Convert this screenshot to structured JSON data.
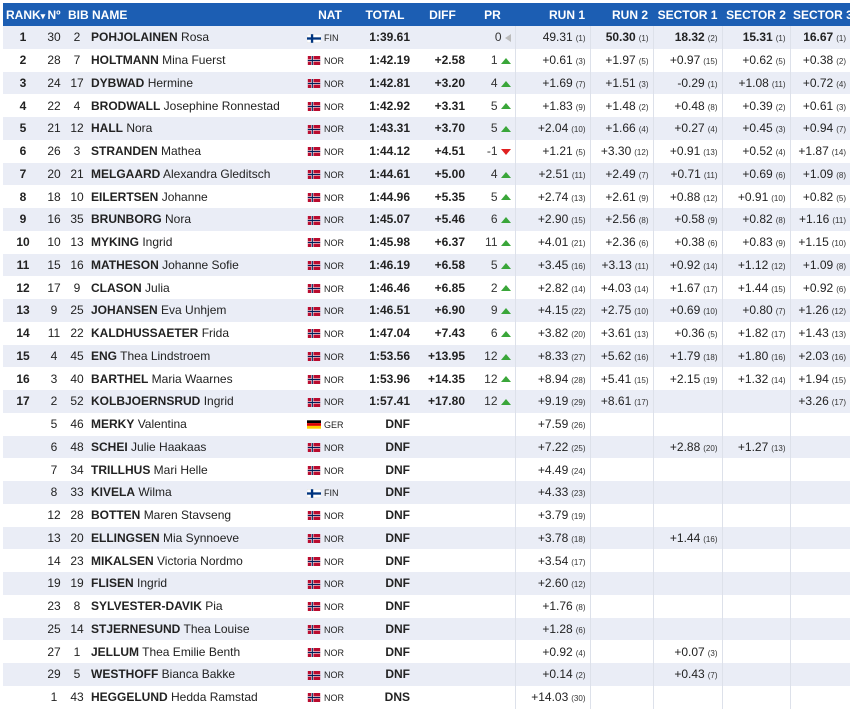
{
  "headers": [
    "RANK",
    "Nº",
    "BIB",
    "NAME",
    "NAT",
    "TOTAL",
    "DIFF",
    "PR",
    "RUN 1",
    "RUN 2",
    "SECTOR 1",
    "SECTOR 2",
    "SECTOR 3"
  ],
  "sort_indicator": "▾",
  "colors": {
    "header_bg": "#1c5eb3",
    "row_alt": "#eaedf6",
    "up": "#3aa63a",
    "down": "#e02020"
  },
  "rows": [
    {
      "rank": "1",
      "no": "30",
      "bib": "2",
      "surname": "POHJOLAINEN",
      "first": "Rosa",
      "nat": "FIN",
      "total": "1:39.61",
      "diff": "",
      "pr": "0",
      "pr_dir": "same",
      "run1": "49.31",
      "run1_rank": "(1)",
      "run2": "50.30",
      "run2_rank": "(1)",
      "s1": "18.32",
      "s1_rank": "(2)",
      "s2": "15.31",
      "s2_rank": "(1)",
      "s3": "16.67",
      "s3_rank": "(1)",
      "best": true
    },
    {
      "rank": "2",
      "no": "28",
      "bib": "7",
      "surname": "HOLTMANN",
      "first": "Mina Fuerst",
      "nat": "NOR",
      "total": "1:42.19",
      "diff": "+2.58",
      "pr": "1",
      "pr_dir": "up",
      "run1": "+0.61",
      "run1_rank": "(3)",
      "run2": "+1.97",
      "run2_rank": "(5)",
      "s1": "+0.97",
      "s1_rank": "(15)",
      "s2": "+0.62",
      "s2_rank": "(5)",
      "s3": "+0.38",
      "s3_rank": "(2)"
    },
    {
      "rank": "3",
      "no": "24",
      "bib": "17",
      "surname": "DYBWAD",
      "first": "Hermine",
      "nat": "NOR",
      "total": "1:42.81",
      "diff": "+3.20",
      "pr": "4",
      "pr_dir": "up",
      "run1": "+1.69",
      "run1_rank": "(7)",
      "run2": "+1.51",
      "run2_rank": "(3)",
      "s1": "-0.29",
      "s1_rank": "(1)",
      "s2": "+1.08",
      "s2_rank": "(11)",
      "s3": "+0.72",
      "s3_rank": "(4)"
    },
    {
      "rank": "4",
      "no": "22",
      "bib": "4",
      "surname": "BRODWALL",
      "first": "Josephine Ronnestad",
      "nat": "NOR",
      "total": "1:42.92",
      "diff": "+3.31",
      "pr": "5",
      "pr_dir": "up",
      "run1": "+1.83",
      "run1_rank": "(9)",
      "run2": "+1.48",
      "run2_rank": "(2)",
      "s1": "+0.48",
      "s1_rank": "(8)",
      "s2": "+0.39",
      "s2_rank": "(2)",
      "s3": "+0.61",
      "s3_rank": "(3)"
    },
    {
      "rank": "5",
      "no": "21",
      "bib": "12",
      "surname": "HALL",
      "first": "Nora",
      "nat": "NOR",
      "total": "1:43.31",
      "diff": "+3.70",
      "pr": "5",
      "pr_dir": "up",
      "run1": "+2.04",
      "run1_rank": "(10)",
      "run2": "+1.66",
      "run2_rank": "(4)",
      "s1": "+0.27",
      "s1_rank": "(4)",
      "s2": "+0.45",
      "s2_rank": "(3)",
      "s3": "+0.94",
      "s3_rank": "(7)"
    },
    {
      "rank": "6",
      "no": "26",
      "bib": "3",
      "surname": "STRANDEN",
      "first": "Mathea",
      "nat": "NOR",
      "total": "1:44.12",
      "diff": "+4.51",
      "pr": "-1",
      "pr_dir": "down",
      "run1": "+1.21",
      "run1_rank": "(5)",
      "run2": "+3.30",
      "run2_rank": "(12)",
      "s1": "+0.91",
      "s1_rank": "(13)",
      "s2": "+0.52",
      "s2_rank": "(4)",
      "s3": "+1.87",
      "s3_rank": "(14)"
    },
    {
      "rank": "7",
      "no": "20",
      "bib": "21",
      "surname": "MELGAARD",
      "first": "Alexandra Gleditsch",
      "nat": "NOR",
      "total": "1:44.61",
      "diff": "+5.00",
      "pr": "4",
      "pr_dir": "up",
      "run1": "+2.51",
      "run1_rank": "(11)",
      "run2": "+2.49",
      "run2_rank": "(7)",
      "s1": "+0.71",
      "s1_rank": "(11)",
      "s2": "+0.69",
      "s2_rank": "(6)",
      "s3": "+1.09",
      "s3_rank": "(8)"
    },
    {
      "rank": "8",
      "no": "18",
      "bib": "10",
      "surname": "EILERTSEN",
      "first": "Johanne",
      "nat": "NOR",
      "total": "1:44.96",
      "diff": "+5.35",
      "pr": "5",
      "pr_dir": "up",
      "run1": "+2.74",
      "run1_rank": "(13)",
      "run2": "+2.61",
      "run2_rank": "(9)",
      "s1": "+0.88",
      "s1_rank": "(12)",
      "s2": "+0.91",
      "s2_rank": "(10)",
      "s3": "+0.82",
      "s3_rank": "(5)"
    },
    {
      "rank": "9",
      "no": "16",
      "bib": "35",
      "surname": "BRUNBORG",
      "first": "Nora",
      "nat": "NOR",
      "total": "1:45.07",
      "diff": "+5.46",
      "pr": "6",
      "pr_dir": "up",
      "run1": "+2.90",
      "run1_rank": "(15)",
      "run2": "+2.56",
      "run2_rank": "(8)",
      "s1": "+0.58",
      "s1_rank": "(9)",
      "s2": "+0.82",
      "s2_rank": "(8)",
      "s3": "+1.16",
      "s3_rank": "(11)"
    },
    {
      "rank": "10",
      "no": "10",
      "bib": "13",
      "surname": "MYKING",
      "first": "Ingrid",
      "nat": "NOR",
      "total": "1:45.98",
      "diff": "+6.37",
      "pr": "11",
      "pr_dir": "up",
      "run1": "+4.01",
      "run1_rank": "(21)",
      "run2": "+2.36",
      "run2_rank": "(6)",
      "s1": "+0.38",
      "s1_rank": "(6)",
      "s2": "+0.83",
      "s2_rank": "(9)",
      "s3": "+1.15",
      "s3_rank": "(10)"
    },
    {
      "rank": "11",
      "no": "15",
      "bib": "16",
      "surname": "MATHESON",
      "first": "Johanne Sofie",
      "nat": "NOR",
      "total": "1:46.19",
      "diff": "+6.58",
      "pr": "5",
      "pr_dir": "up",
      "run1": "+3.45",
      "run1_rank": "(16)",
      "run2": "+3.13",
      "run2_rank": "(11)",
      "s1": "+0.92",
      "s1_rank": "(14)",
      "s2": "+1.12",
      "s2_rank": "(12)",
      "s3": "+1.09",
      "s3_rank": "(8)"
    },
    {
      "rank": "12",
      "no": "17",
      "bib": "9",
      "surname": "CLASON",
      "first": "Julia",
      "nat": "NOR",
      "total": "1:46.46",
      "diff": "+6.85",
      "pr": "2",
      "pr_dir": "up",
      "run1": "+2.82",
      "run1_rank": "(14)",
      "run2": "+4.03",
      "run2_rank": "(14)",
      "s1": "+1.67",
      "s1_rank": "(17)",
      "s2": "+1.44",
      "s2_rank": "(15)",
      "s3": "+0.92",
      "s3_rank": "(6)"
    },
    {
      "rank": "13",
      "no": "9",
      "bib": "25",
      "surname": "JOHANSEN",
      "first": "Eva Unhjem",
      "nat": "NOR",
      "total": "1:46.51",
      "diff": "+6.90",
      "pr": "9",
      "pr_dir": "up",
      "run1": "+4.15",
      "run1_rank": "(22)",
      "run2": "+2.75",
      "run2_rank": "(10)",
      "s1": "+0.69",
      "s1_rank": "(10)",
      "s2": "+0.80",
      "s2_rank": "(7)",
      "s3": "+1.26",
      "s3_rank": "(12)"
    },
    {
      "rank": "14",
      "no": "11",
      "bib": "22",
      "surname": "KALDHUSSAETER",
      "first": "Frida",
      "nat": "NOR",
      "total": "1:47.04",
      "diff": "+7.43",
      "pr": "6",
      "pr_dir": "up",
      "run1": "+3.82",
      "run1_rank": "(20)",
      "run2": "+3.61",
      "run2_rank": "(13)",
      "s1": "+0.36",
      "s1_rank": "(5)",
      "s2": "+1.82",
      "s2_rank": "(17)",
      "s3": "+1.43",
      "s3_rank": "(13)"
    },
    {
      "rank": "15",
      "no": "4",
      "bib": "45",
      "surname": "ENG",
      "first": "Thea Lindstroem",
      "nat": "NOR",
      "total": "1:53.56",
      "diff": "+13.95",
      "pr": "12",
      "pr_dir": "up",
      "run1": "+8.33",
      "run1_rank": "(27)",
      "run2": "+5.62",
      "run2_rank": "(16)",
      "s1": "+1.79",
      "s1_rank": "(18)",
      "s2": "+1.80",
      "s2_rank": "(16)",
      "s3": "+2.03",
      "s3_rank": "(16)"
    },
    {
      "rank": "16",
      "no": "3",
      "bib": "40",
      "surname": "BARTHEL",
      "first": "Maria Waarnes",
      "nat": "NOR",
      "total": "1:53.96",
      "diff": "+14.35",
      "pr": "12",
      "pr_dir": "up",
      "run1": "+8.94",
      "run1_rank": "(28)",
      "run2": "+5.41",
      "run2_rank": "(15)",
      "s1": "+2.15",
      "s1_rank": "(19)",
      "s2": "+1.32",
      "s2_rank": "(14)",
      "s3": "+1.94",
      "s3_rank": "(15)"
    },
    {
      "rank": "17",
      "no": "2",
      "bib": "52",
      "surname": "KOLBJOERNSRUD",
      "first": "Ingrid",
      "nat": "NOR",
      "total": "1:57.41",
      "diff": "+17.80",
      "pr": "12",
      "pr_dir": "up",
      "run1": "+9.19",
      "run1_rank": "(29)",
      "run2": "+8.61",
      "run2_rank": "(17)",
      "s1": "",
      "s1_rank": "",
      "s2": "",
      "s2_rank": "",
      "s3": "+3.26",
      "s3_rank": "(17)"
    },
    {
      "rank": "",
      "no": "5",
      "bib": "46",
      "surname": "MERKY",
      "first": "Valentina",
      "nat": "GER",
      "total": "DNF",
      "diff": "",
      "pr": "",
      "pr_dir": "",
      "run1": "+7.59",
      "run1_rank": "(26)",
      "run2": "",
      "run2_rank": "",
      "s1": "",
      "s1_rank": "",
      "s2": "",
      "s2_rank": "",
      "s3": "",
      "s3_rank": ""
    },
    {
      "rank": "",
      "no": "6",
      "bib": "48",
      "surname": "SCHEI",
      "first": "Julie Haakaas",
      "nat": "NOR",
      "total": "DNF",
      "diff": "",
      "pr": "",
      "pr_dir": "",
      "run1": "+7.22",
      "run1_rank": "(25)",
      "run2": "",
      "run2_rank": "",
      "s1": "+2.88",
      "s1_rank": "(20)",
      "s2": "+1.27",
      "s2_rank": "(13)",
      "s3": "",
      "s3_rank": ""
    },
    {
      "rank": "",
      "no": "7",
      "bib": "34",
      "surname": "TRILLHUS",
      "first": "Mari Helle",
      "nat": "NOR",
      "total": "DNF",
      "diff": "",
      "pr": "",
      "pr_dir": "",
      "run1": "+4.49",
      "run1_rank": "(24)",
      "run2": "",
      "run2_rank": "",
      "s1": "",
      "s1_rank": "",
      "s2": "",
      "s2_rank": "",
      "s3": "",
      "s3_rank": ""
    },
    {
      "rank": "",
      "no": "8",
      "bib": "33",
      "surname": "KIVELA",
      "first": "Wilma",
      "nat": "FIN",
      "total": "DNF",
      "diff": "",
      "pr": "",
      "pr_dir": "",
      "run1": "+4.33",
      "run1_rank": "(23)",
      "run2": "",
      "run2_rank": "",
      "s1": "",
      "s1_rank": "",
      "s2": "",
      "s2_rank": "",
      "s3": "",
      "s3_rank": ""
    },
    {
      "rank": "",
      "no": "12",
      "bib": "28",
      "surname": "BOTTEN",
      "first": "Maren Stavseng",
      "nat": "NOR",
      "total": "DNF",
      "diff": "",
      "pr": "",
      "pr_dir": "",
      "run1": "+3.79",
      "run1_rank": "(19)",
      "run2": "",
      "run2_rank": "",
      "s1": "",
      "s1_rank": "",
      "s2": "",
      "s2_rank": "",
      "s3": "",
      "s3_rank": ""
    },
    {
      "rank": "",
      "no": "13",
      "bib": "20",
      "surname": "ELLINGSEN",
      "first": "Mia Synnoeve",
      "nat": "NOR",
      "total": "DNF",
      "diff": "",
      "pr": "",
      "pr_dir": "",
      "run1": "+3.78",
      "run1_rank": "(18)",
      "run2": "",
      "run2_rank": "",
      "s1": "+1.44",
      "s1_rank": "(16)",
      "s2": "",
      "s2_rank": "",
      "s3": "",
      "s3_rank": ""
    },
    {
      "rank": "",
      "no": "14",
      "bib": "23",
      "surname": "MIKALSEN",
      "first": "Victoria Nordmo",
      "nat": "NOR",
      "total": "DNF",
      "diff": "",
      "pr": "",
      "pr_dir": "",
      "run1": "+3.54",
      "run1_rank": "(17)",
      "run2": "",
      "run2_rank": "",
      "s1": "",
      "s1_rank": "",
      "s2": "",
      "s2_rank": "",
      "s3": "",
      "s3_rank": ""
    },
    {
      "rank": "",
      "no": "19",
      "bib": "19",
      "surname": "FLISEN",
      "first": "Ingrid",
      "nat": "NOR",
      "total": "DNF",
      "diff": "",
      "pr": "",
      "pr_dir": "",
      "run1": "+2.60",
      "run1_rank": "(12)",
      "run2": "",
      "run2_rank": "",
      "s1": "",
      "s1_rank": "",
      "s2": "",
      "s2_rank": "",
      "s3": "",
      "s3_rank": ""
    },
    {
      "rank": "",
      "no": "23",
      "bib": "8",
      "surname": "SYLVESTER-DAVIK",
      "first": "Pia",
      "nat": "NOR",
      "total": "DNF",
      "diff": "",
      "pr": "",
      "pr_dir": "",
      "run1": "+1.76",
      "run1_rank": "(8)",
      "run2": "",
      "run2_rank": "",
      "s1": "",
      "s1_rank": "",
      "s2": "",
      "s2_rank": "",
      "s3": "",
      "s3_rank": ""
    },
    {
      "rank": "",
      "no": "25",
      "bib": "14",
      "surname": "STJERNESUND",
      "first": "Thea Louise",
      "nat": "NOR",
      "total": "DNF",
      "diff": "",
      "pr": "",
      "pr_dir": "",
      "run1": "+1.28",
      "run1_rank": "(6)",
      "run2": "",
      "run2_rank": "",
      "s1": "",
      "s1_rank": "",
      "s2": "",
      "s2_rank": "",
      "s3": "",
      "s3_rank": ""
    },
    {
      "rank": "",
      "no": "27",
      "bib": "1",
      "surname": "JELLUM",
      "first": "Thea Emilie Benth",
      "nat": "NOR",
      "total": "DNF",
      "diff": "",
      "pr": "",
      "pr_dir": "",
      "run1": "+0.92",
      "run1_rank": "(4)",
      "run2": "",
      "run2_rank": "",
      "s1": "+0.07",
      "s1_rank": "(3)",
      "s2": "",
      "s2_rank": "",
      "s3": "",
      "s3_rank": ""
    },
    {
      "rank": "",
      "no": "29",
      "bib": "5",
      "surname": "WESTHOFF",
      "first": "Bianca Bakke",
      "nat": "NOR",
      "total": "DNF",
      "diff": "",
      "pr": "",
      "pr_dir": "",
      "run1": "+0.14",
      "run1_rank": "(2)",
      "run2": "",
      "run2_rank": "",
      "s1": "+0.43",
      "s1_rank": "(7)",
      "s2": "",
      "s2_rank": "",
      "s3": "",
      "s3_rank": ""
    },
    {
      "rank": "",
      "no": "1",
      "bib": "43",
      "surname": "HEGGELUND",
      "first": "Hedda Ramstad",
      "nat": "NOR",
      "total": "DNS",
      "diff": "",
      "pr": "",
      "pr_dir": "",
      "run1": "+14.03",
      "run1_rank": "(30)",
      "run2": "",
      "run2_rank": "",
      "s1": "",
      "s1_rank": "",
      "s2": "",
      "s2_rank": "",
      "s3": "",
      "s3_rank": ""
    }
  ]
}
